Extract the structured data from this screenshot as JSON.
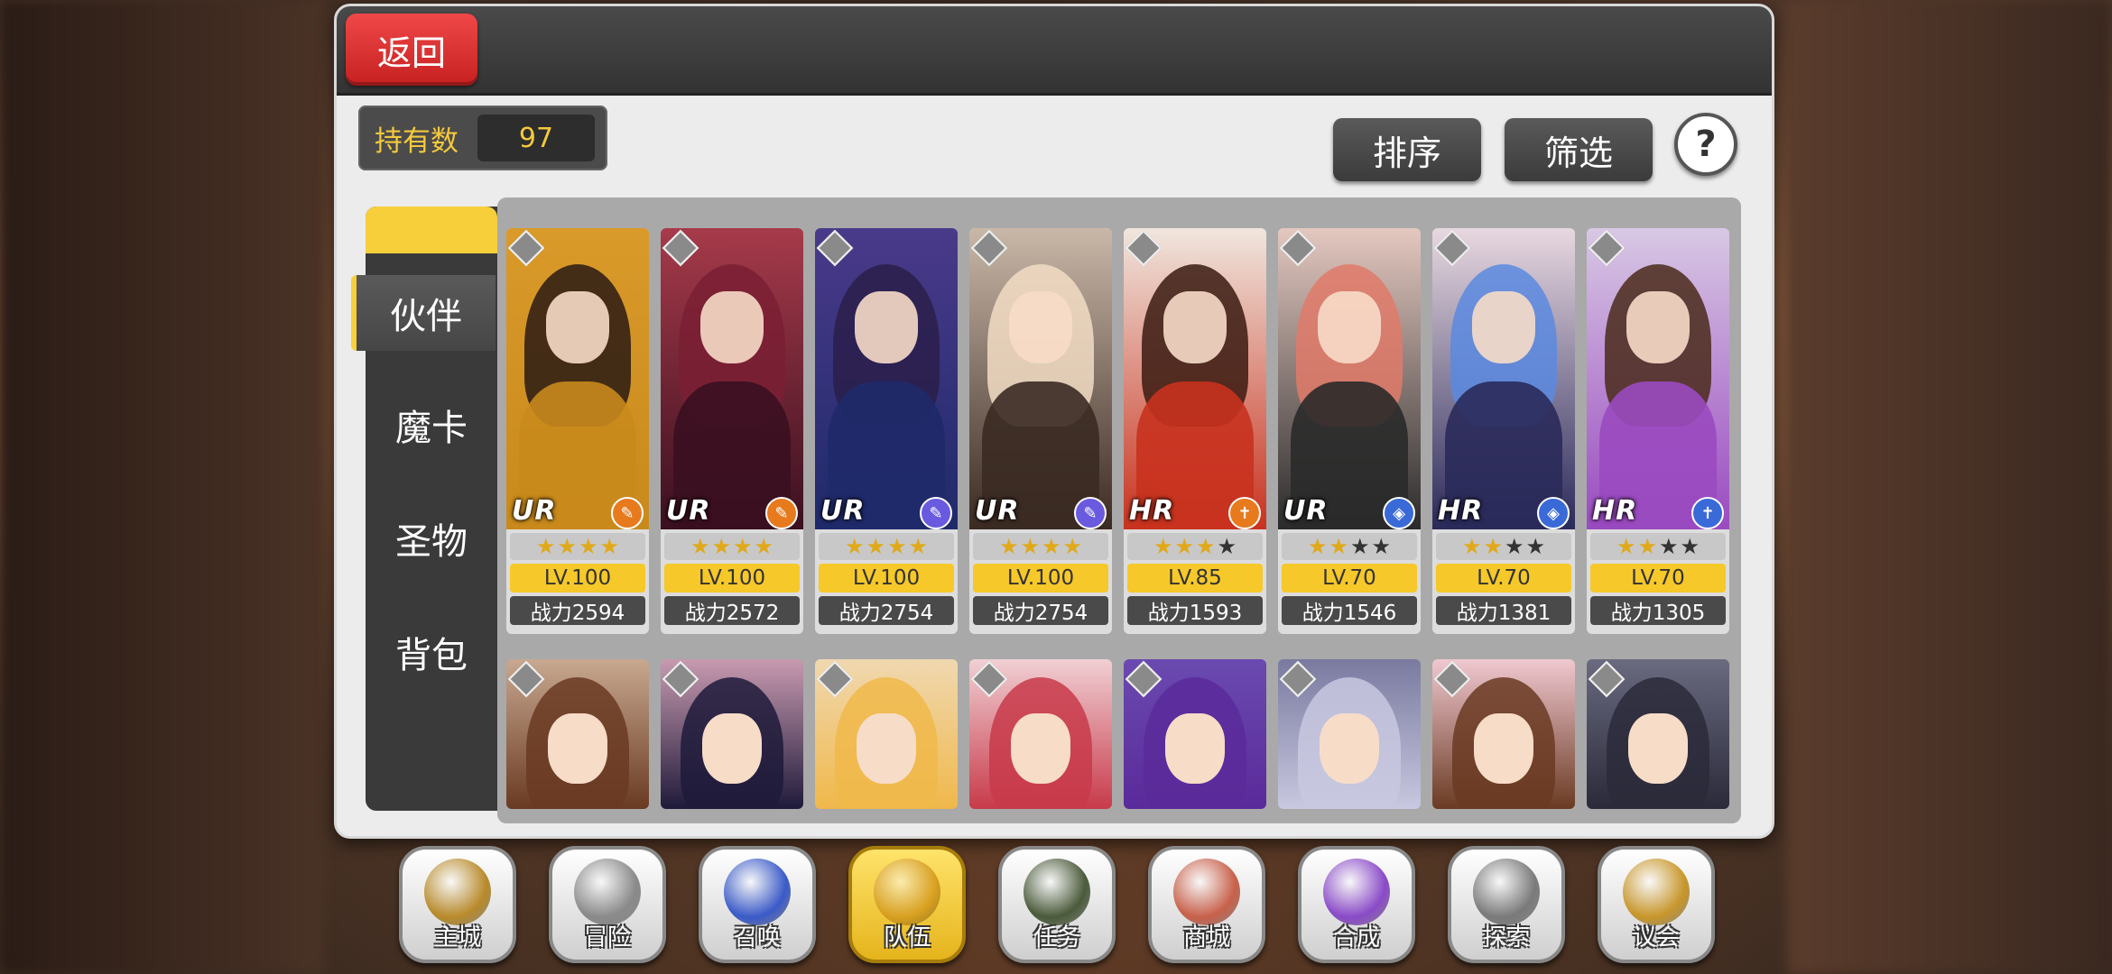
{
  "header": {
    "back_label": "返回"
  },
  "owned": {
    "label": "持有数",
    "value": "97"
  },
  "toolbar": {
    "sort_label": "排序",
    "filter_label": "筛选",
    "help_label": "?"
  },
  "tabs": [
    {
      "label": "伙伴",
      "active": true
    },
    {
      "label": "魔卡",
      "active": false
    },
    {
      "label": "圣物",
      "active": false
    },
    {
      "label": "背包",
      "active": false
    }
  ],
  "characters": [
    {
      "rarity": "UR",
      "stars": 4,
      "max_stars": 4,
      "level": "LV.100",
      "power": "战力2594",
      "class_icon": "wrench-icon",
      "class_color": "#e87a1e",
      "hair": "#2a1a14",
      "outfit": "#c98a1c",
      "bg": "#d99a2a"
    },
    {
      "rarity": "UR",
      "stars": 4,
      "max_stars": 4,
      "level": "LV.100",
      "power": "战力2572",
      "class_icon": "wrench-icon",
      "class_color": "#e87a1e",
      "hair": "#7a1f34",
      "outfit": "#3a1020",
      "bg": "#a63a4a"
    },
    {
      "rarity": "UR",
      "stars": 4,
      "max_stars": 4,
      "level": "LV.100",
      "power": "战力2754",
      "class_icon": "staff-icon",
      "class_color": "#6a5ae0",
      "hair": "#2a1f4a",
      "outfit": "#1f2a6a",
      "bg": "#4a3a8a"
    },
    {
      "rarity": "UR",
      "stars": 4,
      "max_stars": 4,
      "level": "LV.100",
      "power": "战力2754",
      "class_icon": "staff-icon",
      "class_color": "#6a5ae0",
      "hair": "#f2dcc4",
      "outfit": "#3a2a22",
      "bg": "#c9b8a8"
    },
    {
      "rarity": "HR",
      "stars": 3,
      "max_stars": 4,
      "level": "LV.85",
      "power": "战力1593",
      "class_icon": "cross-icon",
      "class_color": "#e87a1e",
      "hair": "#3a1a10",
      "outfit": "#c8321e",
      "bg": "#f0e6de"
    },
    {
      "rarity": "UR",
      "stars": 2,
      "max_stars": 4,
      "level": "LV.70",
      "power": "战力1546",
      "class_icon": "shield-icon",
      "class_color": "#3a6ad8",
      "hair": "#e07a6a",
      "outfit": "#2a2a2a",
      "bg": "#e4c8c0"
    },
    {
      "rarity": "HR",
      "stars": 2,
      "max_stars": 4,
      "level": "LV.70",
      "power": "战力1381",
      "class_icon": "shield-icon",
      "class_color": "#3a6ad8",
      "hair": "#5a8ae0",
      "outfit": "#2a2a5a",
      "bg": "#e8d8e0"
    },
    {
      "rarity": "HR",
      "stars": 2,
      "max_stars": 4,
      "level": "LV.70",
      "power": "战力1305",
      "class_icon": "cross-icon",
      "class_color": "#3a6ad8",
      "hair": "#4a2a1a",
      "outfit": "#9a4ac0",
      "bg": "#d8c8e4"
    }
  ],
  "characters_row2": [
    {
      "hair": "#6a3a22",
      "bg": "#c8a890"
    },
    {
      "hair": "#1f1a3a",
      "bg": "#c89ab0"
    },
    {
      "hair": "#f0b84a",
      "bg": "#f0d8b0"
    },
    {
      "hair": "#c83a4a",
      "bg": "#f0d0d4"
    },
    {
      "hair": "#5a2a9a",
      "bg": "#6a4ab0"
    },
    {
      "hair": "#c8c8e0",
      "bg": "#7a7aa0"
    },
    {
      "hair": "#6a3a22",
      "bg": "#f0c8d0"
    },
    {
      "hair": "#2a2a3a",
      "bg": "#6a6a80"
    }
  ],
  "nav": [
    {
      "label": "主城",
      "icon": "crown-castle-icon",
      "active": false,
      "art": "#b88a2a"
    },
    {
      "label": "冒险",
      "icon": "crossed-swords-icon",
      "active": false,
      "art": "#8a8a8a"
    },
    {
      "label": "召唤",
      "icon": "summon-card-icon",
      "active": false,
      "art": "#3a5ac8"
    },
    {
      "label": "队伍",
      "icon": "team-helmet-icon",
      "active": true,
      "art": "#d8a020"
    },
    {
      "label": "任务",
      "icon": "quest-book-icon",
      "active": false,
      "art": "#4a5a3a"
    },
    {
      "label": "商城",
      "icon": "shop-tree-icon",
      "active": false,
      "art": "#c8604a"
    },
    {
      "label": "合成",
      "icon": "synthesis-flask-icon",
      "active": false,
      "art": "#8a4ac8"
    },
    {
      "label": "探索",
      "icon": "explore-compass-icon",
      "active": false,
      "art": "#7a7a7a"
    },
    {
      "label": "议会",
      "icon": "council-crest-icon",
      "active": false,
      "art": "#c8962a"
    }
  ]
}
